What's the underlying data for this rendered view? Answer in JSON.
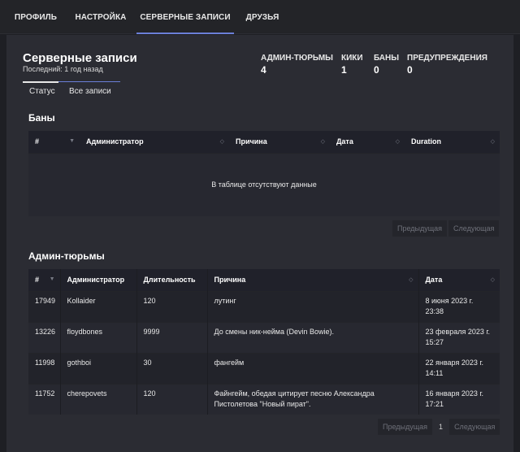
{
  "nav": {
    "tabs": [
      {
        "label": "ПРОФИЛЬ"
      },
      {
        "label": "НАСТРОЙКА"
      },
      {
        "label": "СЕРВЕРНЫЕ ЗАПИСИ"
      },
      {
        "label": "ДРУЗЬЯ"
      }
    ],
    "active_index": 2
  },
  "header": {
    "title": "Серверные записи",
    "subtitle": "Последний: 1 год назад"
  },
  "stats": [
    {
      "label": "АДМИН-ТЮРЬМЫ",
      "value": "4"
    },
    {
      "label": "КИКИ",
      "value": "1"
    },
    {
      "label": "БАНЫ",
      "value": "0"
    },
    {
      "label": "ПРЕДУПРЕЖДЕНИЯ",
      "value": "0"
    }
  ],
  "subtabs": [
    "Статус",
    "Все записи"
  ],
  "bans": {
    "title": "Баны",
    "columns": [
      "#",
      "Администратор",
      "Причина",
      "Дата",
      "Duration"
    ],
    "empty_text": "В таблице отсутствуют данные",
    "prev": "Предыдущая",
    "next": "Следующая"
  },
  "jails": {
    "title": "Админ-тюрьмы",
    "columns": [
      "#",
      "Администратор",
      "Длительность",
      "Причина",
      "Дата"
    ],
    "rows": [
      {
        "id": "17949",
        "admin": "Kollaider",
        "duration": "120",
        "reason": "лутинг",
        "date": "8 июня 2023 г.",
        "time": "23:38"
      },
      {
        "id": "13226",
        "admin": "floydbones",
        "duration": "9999",
        "reason": "До смены ник-нейма (Devin Bowie).",
        "date": "23 февраля 2023 г.",
        "time": "15:27"
      },
      {
        "id": "11998",
        "admin": "gothboi",
        "duration": "30",
        "reason": "фангейм",
        "date": "22 января 2023 г.",
        "time": "14:11"
      },
      {
        "id": "11752",
        "admin": "cherepovets",
        "duration": "120",
        "reason": "Файнгейм, обедая цитирует песню Александра Пистолетова \"Новый пират\".",
        "date": "16 января 2023 г.",
        "time": "17:21"
      }
    ],
    "prev": "Предыдущая",
    "page": "1",
    "next": "Следующая"
  },
  "colors": {
    "accent": "#6b7fd8",
    "background": "#1e1f24",
    "panel": "#2b2c33"
  }
}
